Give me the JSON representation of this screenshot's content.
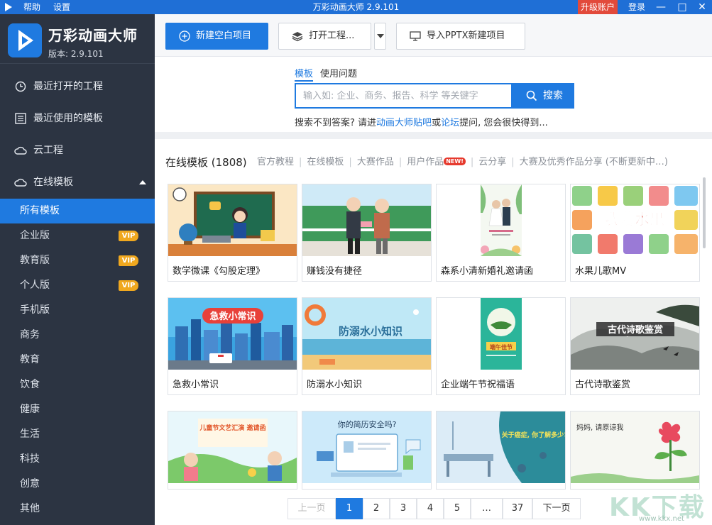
{
  "titlebar": {
    "menu": [
      "帮助",
      "设置"
    ],
    "title": "万彩动画大师 2.9.101",
    "upgrade": "升级账户",
    "login": "登录",
    "controls": [
      "—",
      "□",
      "✕"
    ],
    "color": "#1f6fd6"
  },
  "brand": {
    "name": "万彩动画大师",
    "version": "版本: 2.9.101"
  },
  "sidebar": {
    "main": [
      {
        "label": "最近打开的工程",
        "icon": "clock-icon"
      },
      {
        "label": "最近使用的模板",
        "icon": "list-icon"
      },
      {
        "label": "云工程",
        "icon": "cloud-icon"
      },
      {
        "label": "在线模板",
        "icon": "cloud-icon"
      }
    ],
    "sub": [
      {
        "label": "所有模板",
        "active": true
      },
      {
        "label": "企业版",
        "badge": "VIP"
      },
      {
        "label": "教育版",
        "badge": "VIP"
      },
      {
        "label": "个人版",
        "badge": "VIP"
      },
      {
        "label": "手机版"
      },
      {
        "label": "商务"
      },
      {
        "label": "教育"
      },
      {
        "label": "饮食"
      },
      {
        "label": "健康"
      },
      {
        "label": "生活"
      },
      {
        "label": "科技"
      },
      {
        "label": "创意"
      },
      {
        "label": "其他"
      }
    ],
    "accent": "#1f7ae0"
  },
  "toolbar": {
    "new_project": "新建空白项目",
    "open_project": "打开工程...",
    "import_pptx": "导入PPTX新建项目"
  },
  "search": {
    "tabs": [
      "模板",
      "使用问题"
    ],
    "placeholder": "输入如: 企业、商务、报告、科学 等关键字",
    "button": "搜索",
    "hint_before": "搜索不到答案? 请进",
    "hint_link1": "动画大师贴吧",
    "hint_or": "或",
    "hint_link2": "论坛",
    "hint_after": "提问, 您会很快得到..."
  },
  "categories": {
    "title": "在线模板 (1808)",
    "links": [
      "官方教程",
      "在线模板",
      "大赛作品",
      "用户作品",
      "云分享",
      "大赛及优秀作品分享 (不断更新中…)"
    ],
    "new_badge": "NEW!"
  },
  "templates": [
    {
      "title": "数学微课《勾股定理》"
    },
    {
      "title": "赚钱没有捷径"
    },
    {
      "title": "森系小清新婚礼邀请函"
    },
    {
      "title": "水果儿歌MV",
      "art": "我爱水果"
    },
    {
      "title": "急救小常识",
      "art": "急救小常识"
    },
    {
      "title": "防溺水小知识",
      "art": "防溺水小知识"
    },
    {
      "title": "企业端午节祝福语",
      "art": "端午佳节"
    },
    {
      "title": "古代诗歌鉴赏",
      "art": "古代诗歌鉴赏"
    },
    {
      "title": "",
      "art": "儿童节文艺汇演 邀请函"
    },
    {
      "title": "",
      "art": "你的简历安全吗?"
    },
    {
      "title": "",
      "art": "关于癌症, 你了解多少?"
    },
    {
      "title": "",
      "art": "妈妈, 请原谅我"
    }
  ],
  "pagination": {
    "prev": "上一页",
    "pages": [
      "1",
      "2",
      "3",
      "4",
      "5",
      "…",
      "37"
    ],
    "next": "下一页",
    "current": "1"
  },
  "watermark": {
    "text": "KK下载",
    "url": "www.kkx.net"
  }
}
